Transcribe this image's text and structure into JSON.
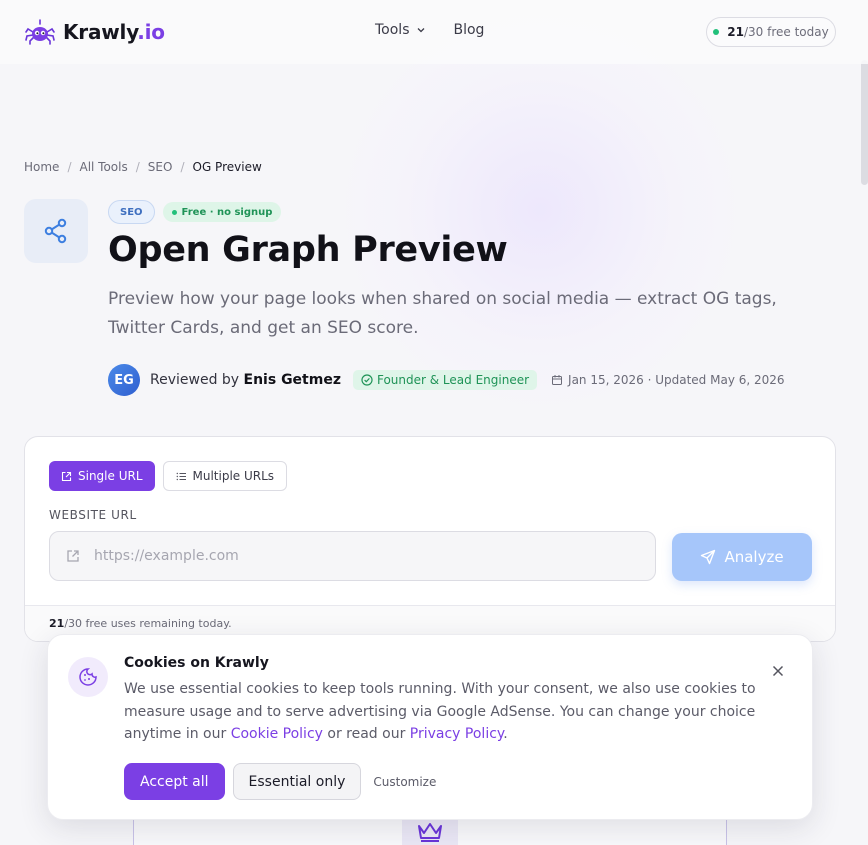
{
  "header": {
    "brand_name": "Krawly",
    "brand_tld": ".io",
    "nav": [
      {
        "label": "Tools",
        "has_dropdown": true
      },
      {
        "label": "Blog",
        "has_dropdown": false
      }
    ],
    "quota": {
      "used": "21",
      "rest": "/30 free today"
    }
  },
  "breadcrumb": [
    "Home",
    "All Tools",
    "SEO",
    "OG Preview"
  ],
  "hero": {
    "category_badge": "SEO",
    "free_badge": "Free · no signup",
    "title": "Open Graph Preview",
    "subtitle": "Preview how your page looks when shared on social media — extract OG tags, Twitter Cards, and get an SEO score.",
    "author_initials": "EG",
    "reviewed_by_prefix": "Reviewed by",
    "author_name": "Enis Getmez",
    "author_role": "Founder & Lead Engineer",
    "dates": "Jan 15, 2026 · Updated May 6, 2026"
  },
  "tool": {
    "tabs": [
      {
        "label": "Single URL",
        "active": true
      },
      {
        "label": "Multiple URLs",
        "active": false
      }
    ],
    "field_label": "WEBSITE URL",
    "url_placeholder": "https://example.com",
    "url_value": "",
    "analyze_label": "Analyze",
    "footer_used": "21",
    "footer_rest": "/30 free uses remaining today."
  },
  "cookie": {
    "title": "Cookies on Krawly",
    "text_part1": "We use essential cookies to keep tools running. With your consent, we also use cookies to measure usage and to serve advertising via Google AdSense. You can change your choice anytime in our ",
    "cookie_policy_link": "Cookie Policy",
    "text_part2": " or read our ",
    "privacy_policy_link": "Privacy Policy",
    "text_part3": ".",
    "accept_label": "Accept all",
    "essential_label": "Essential only",
    "customize_label": "Customize"
  },
  "colors": {
    "accent": "#7b3fe4",
    "analyze_disabled": "#a6c6fa",
    "success": "#22c07a",
    "background": "#f6f6f9"
  }
}
